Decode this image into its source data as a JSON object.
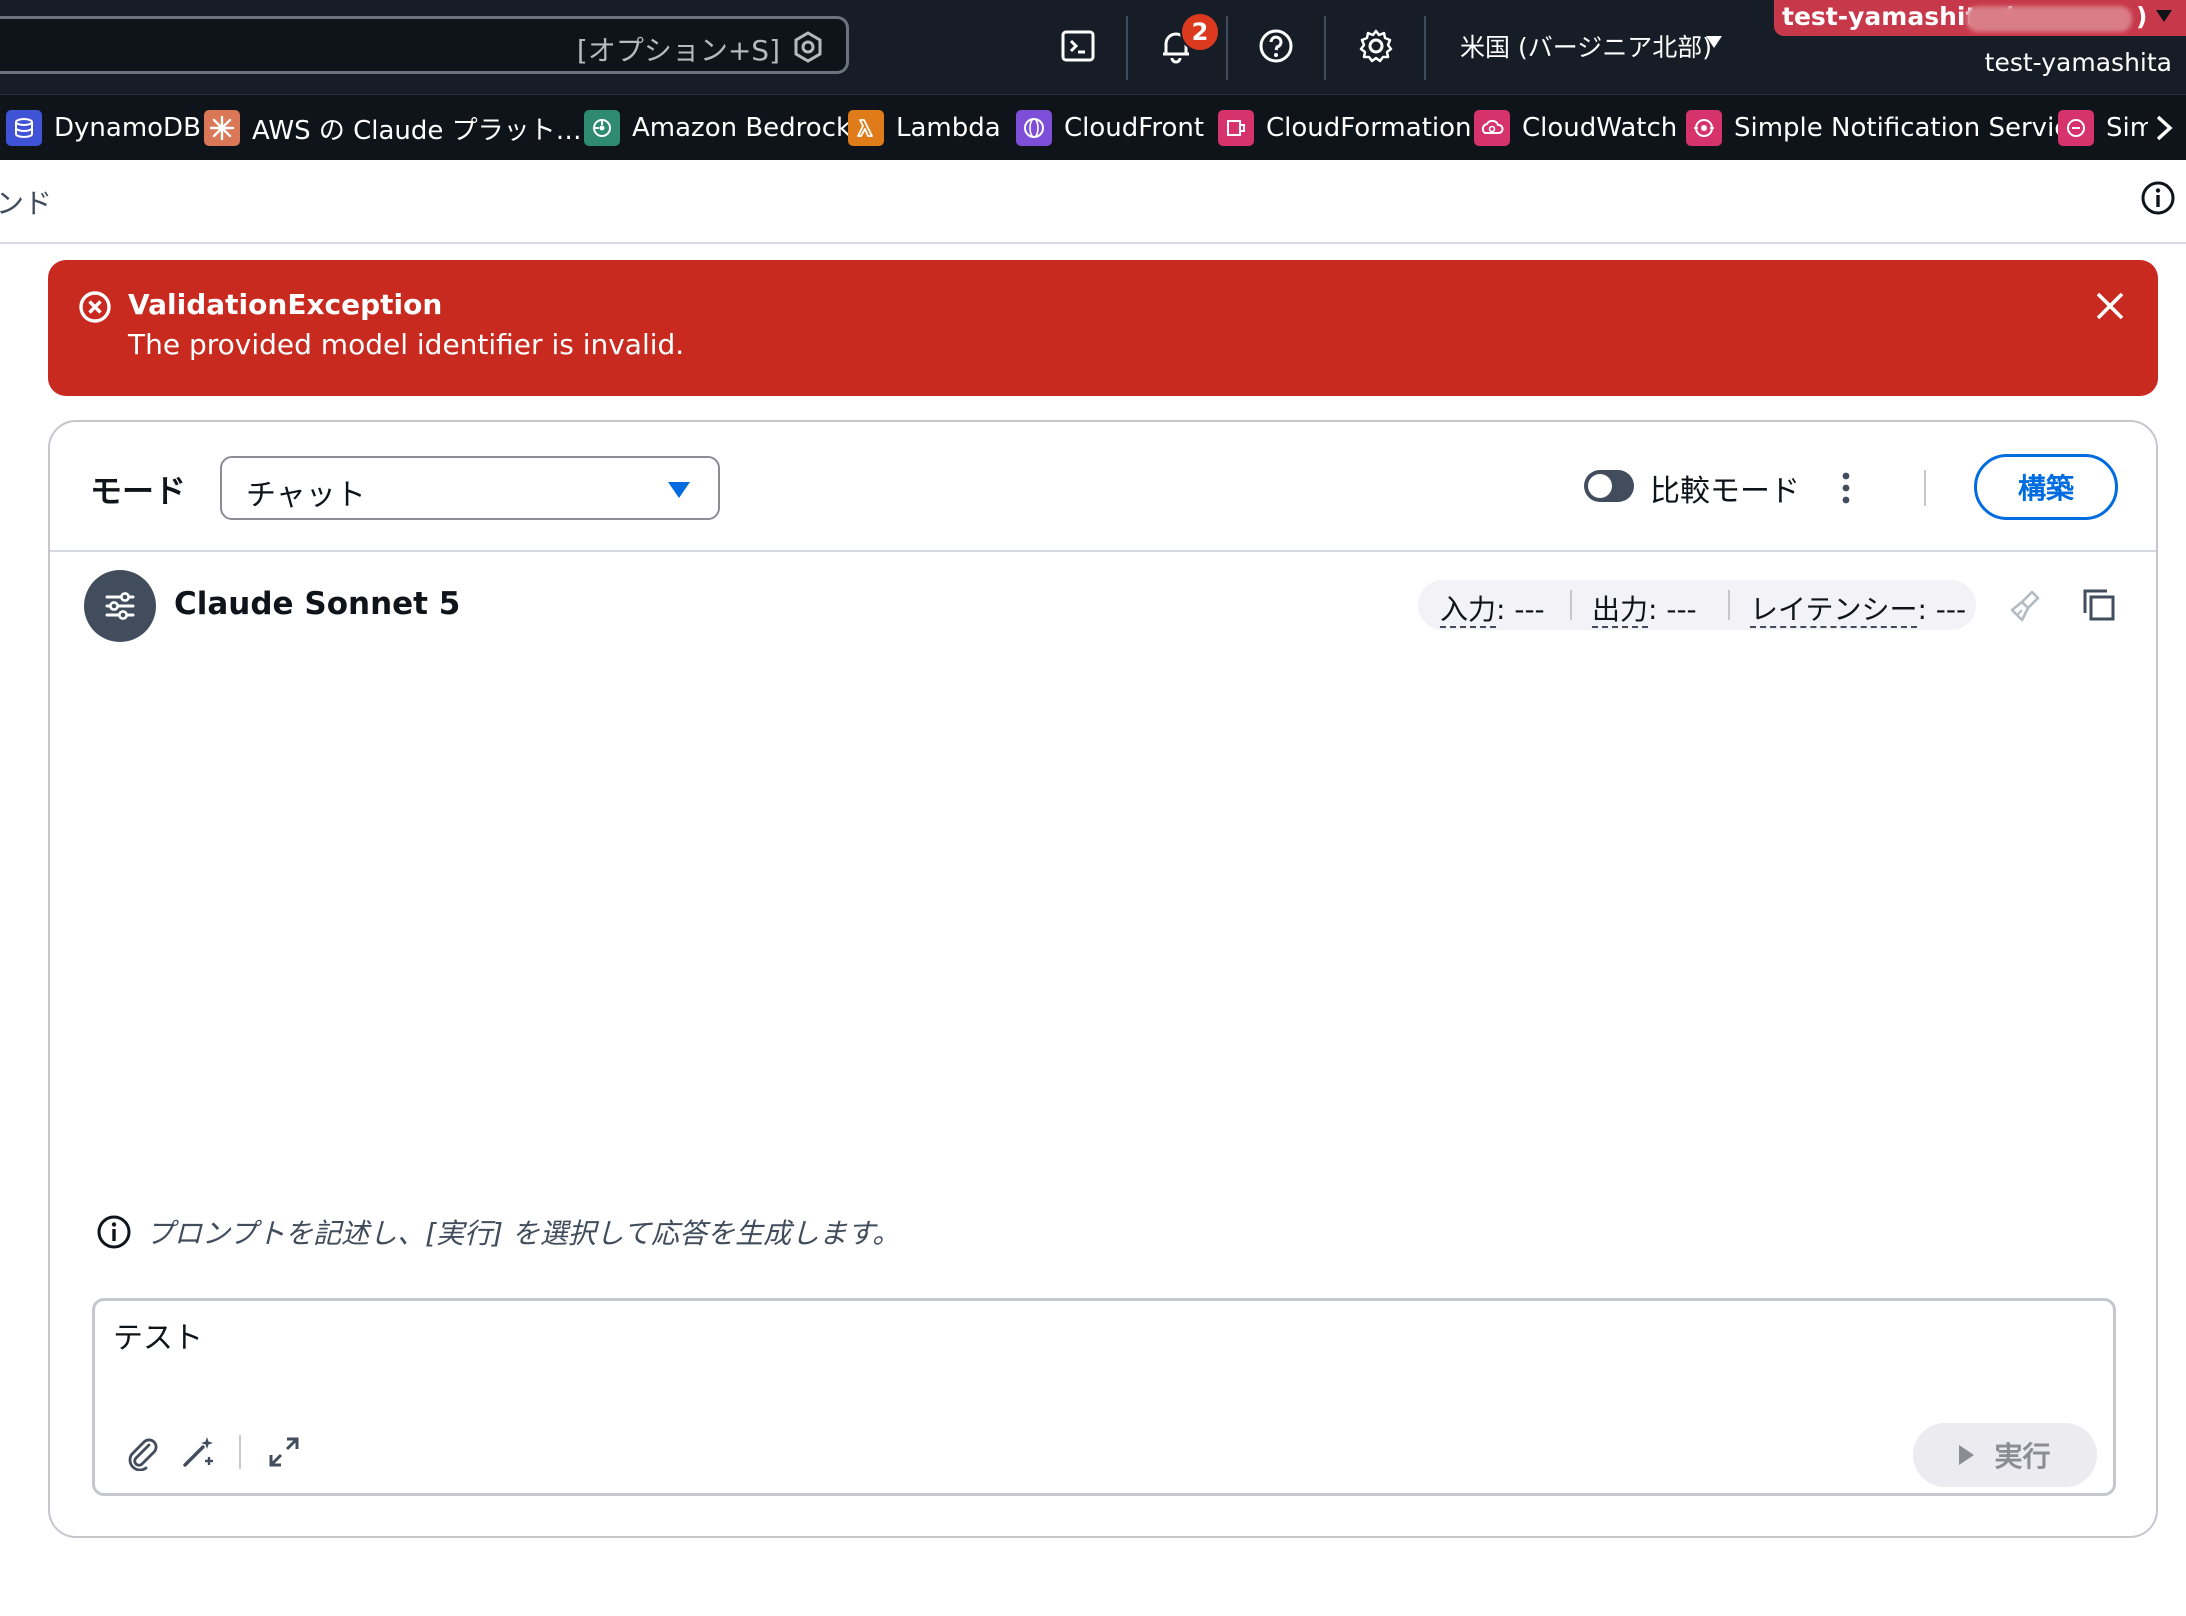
{
  "topnav": {
    "search_shortcut": "[オプション+S]",
    "notification_count": "2",
    "region": "米国 (バージニア北部)",
    "account_label": "test-yamashita (",
    "account_paren": ")",
    "account_name": "test-yamashita"
  },
  "services": [
    {
      "label": "DynamoDB",
      "icon": "dynamodb-icon",
      "color": "#4053d6"
    },
    {
      "label": "AWS の Claude プラット…",
      "icon": "claude-icon",
      "color": "#d97757"
    },
    {
      "label": "Amazon Bedrock",
      "icon": "bedrock-icon",
      "color": "#2e8b72"
    },
    {
      "label": "Lambda",
      "icon": "lambda-icon",
      "color": "#e07b1a"
    },
    {
      "label": "CloudFront",
      "icon": "cloudfront-icon",
      "color": "#7d4fd8"
    },
    {
      "label": "CloudFormation",
      "icon": "cloudformation-icon",
      "color": "#d6336c"
    },
    {
      "label": "CloudWatch",
      "icon": "cloudwatch-icon",
      "color": "#d6336c"
    },
    {
      "label": "Simple Notification Service",
      "icon": "sns-icon",
      "color": "#d6336c"
    },
    {
      "label": "Sim",
      "icon": "sqs-icon",
      "color": "#d6336c"
    }
  ],
  "breadcrumb": {
    "text": "ンド"
  },
  "flash": {
    "title": "ValidationException",
    "message": "The provided model identifier is invalid."
  },
  "panel": {
    "mode_label": "モード",
    "mode_value": "チャット",
    "compare_label": "比較モード",
    "build_label": "構築",
    "model_name": "Claude Sonnet 5",
    "metrics": {
      "input_key": "入力",
      "input_val": ": ---",
      "output_key": "出力",
      "output_val": ": ---",
      "latency_key": "レイテンシー",
      "latency_val": ": ---"
    },
    "hint": "プロンプトを記述し、[実行] を選択して応答を生成します。",
    "prompt_value": "テスト",
    "run_label": "実行"
  },
  "colors": {
    "nav_bg": "#161d26",
    "error_red": "#c82a1f",
    "accent_blue": "#006ce0",
    "account_pink": "#c7384a"
  }
}
